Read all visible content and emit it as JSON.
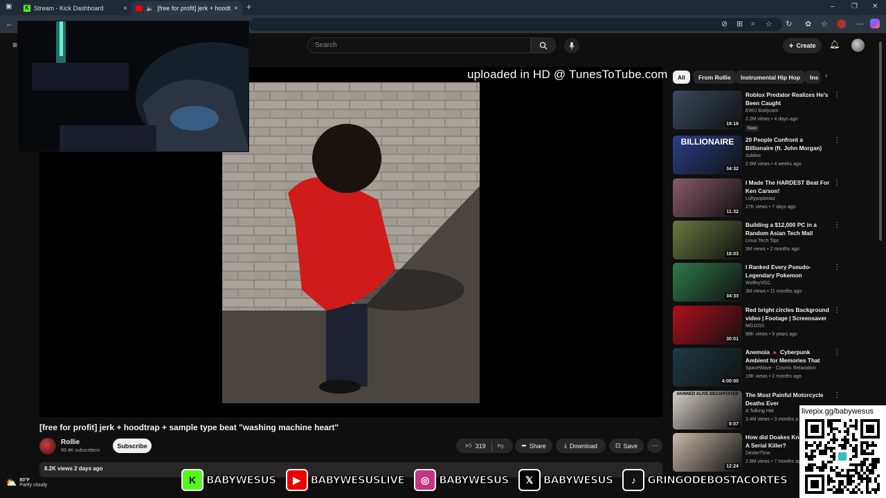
{
  "browser": {
    "tabs": [
      {
        "label": "Stream - Kick Dashboard",
        "icon": "kick-icon",
        "close": "×"
      },
      {
        "label": "[free for profit] jerk + hoodt",
        "icon": "youtube-icon",
        "close": "×"
      }
    ],
    "new_tab": "+",
    "window_controls": {
      "minimize": "–",
      "restore": "❐",
      "close": "✕"
    }
  },
  "youtube": {
    "search_placeholder": "Search",
    "create_label": "Create",
    "overlay_text": "uploaded in HD @ TunesToTube.com",
    "video": {
      "title": "[free for profit] jerk + hoodtrap + sample type beat \"washing machine heart\"",
      "channel": "Rollie",
      "subscribers": "99.4K subscribers",
      "subscribe_label": "Subscribe",
      "likes": "319",
      "share_label": "Share",
      "download_label": "Download",
      "save_label": "Save",
      "views_date": "8.2K views  2 days ago"
    },
    "chips": [
      "All",
      "From Rollie",
      "Instrumental Hip Hop",
      "Ins"
    ],
    "recommendations": [
      {
        "title": "Roblox Predator Realizes He's Been Caught",
        "channel": "EWU Bodycam",
        "meta": "2.2M views • 4 days ago",
        "duration": "19:18",
        "badge": "New",
        "color": "#3a4a60"
      },
      {
        "title": "20 People Confront a Billionaire (ft. John Morgan)",
        "channel": "Jubilee",
        "meta": "2.6M views • 4 weeks ago",
        "duration": "34:32",
        "overlay": "BILLIONAIRE",
        "color": "#2a3f8a"
      },
      {
        "title": "I Made The HARDEST Beat For Ken Carson!",
        "channel": "Lollypopbeatz",
        "meta": "27K views • 7 days ago",
        "duration": "11:32",
        "color": "#8a5a6a"
      },
      {
        "title": "Building a $12,000 PC in a Random Asian Tech Mall",
        "channel": "Linus Tech Tips",
        "meta": "3M views • 2 months ago",
        "duration": "18:03",
        "color": "#6a7a40"
      },
      {
        "title": "I Ranked Every Pseudo-Legendary Pokemon",
        "channel": "WolfeyVGC",
        "meta": "3M views • 11 months ago",
        "duration": "34:33",
        "color": "#2f7a4a"
      },
      {
        "title": "Red bright circles Background video | Footage | Screensaver",
        "channel": "MG1010",
        "meta": "88K views • 5 years ago",
        "duration": "30:01",
        "color": "#b0101c"
      },
      {
        "title": "Anemoia 🔺 Cyberpunk Ambient for Memories That Don't Belon...",
        "channel": "SpaceWave - Cosmic Relaxation",
        "meta": "19K views • 2 months ago",
        "duration": "4:00:00",
        "color": "#1e3a44"
      },
      {
        "title": "The Most Painful Motorcycle Deaths Ever",
        "channel": "A Talking Hat",
        "meta": "3.4M views • 3 months a",
        "duration": "8:07",
        "overlay2": "SKINNED ALIVE   DECAPITATED",
        "color": "#d8d0c8"
      },
      {
        "title": "How did Doakes Know He Was A Serial Killer?",
        "channel": "DexterTime",
        "meta": "2.8M views • 7 months ag",
        "duration": "12:24",
        "color": "#c8b8a8"
      }
    ]
  },
  "weather": {
    "temp": "80°F",
    "desc": "Partly cloudy"
  },
  "socials": [
    {
      "name": "BABYWESUS",
      "icon": "kick-icon",
      "glyph": "K",
      "color": "#53fc18"
    },
    {
      "name": "BABYWESUSLIVE",
      "icon": "youtube-icon",
      "glyph": "▶",
      "color": "#e00"
    },
    {
      "name": "BABYWESUS",
      "icon": "instagram-icon",
      "glyph": "◎",
      "color": "#c13584"
    },
    {
      "name": "BABYWESUS",
      "icon": "x-icon",
      "glyph": "𝕏",
      "color": "#000"
    },
    {
      "name": "GRINGODEBOSTACORTES",
      "icon": "tiktok-icon",
      "glyph": "♪",
      "color": "#111"
    }
  ],
  "qr": {
    "label": "livepix.gg/babywesus"
  }
}
